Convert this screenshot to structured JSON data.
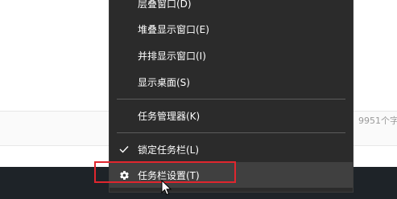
{
  "editor": {
    "word_count_text": "9951个字"
  },
  "context_menu": {
    "items": [
      {
        "label": "层叠窗口(D)",
        "icon": "",
        "hovered": false
      },
      {
        "label": "堆叠显示窗口(E)",
        "icon": "",
        "hovered": false
      },
      {
        "label": "并排显示窗口(I)",
        "icon": "",
        "hovered": false
      },
      {
        "label": "显示桌面(S)",
        "icon": "",
        "hovered": false
      },
      {
        "label": "任务管理器(K)",
        "icon": "",
        "hovered": false
      },
      {
        "label": "锁定任务栏(L)",
        "icon": "checkmark-icon",
        "hovered": false
      },
      {
        "label": "任务栏设置(T)",
        "icon": "gear-icon",
        "hovered": true
      }
    ]
  },
  "colors": {
    "menu_background": "#2b2b2b",
    "menu_hover": "#404040",
    "menu_text": "#ffffff",
    "separator": "#5c5c5c",
    "taskbar": "#1e2328",
    "highlight_box": "#e0262e"
  }
}
